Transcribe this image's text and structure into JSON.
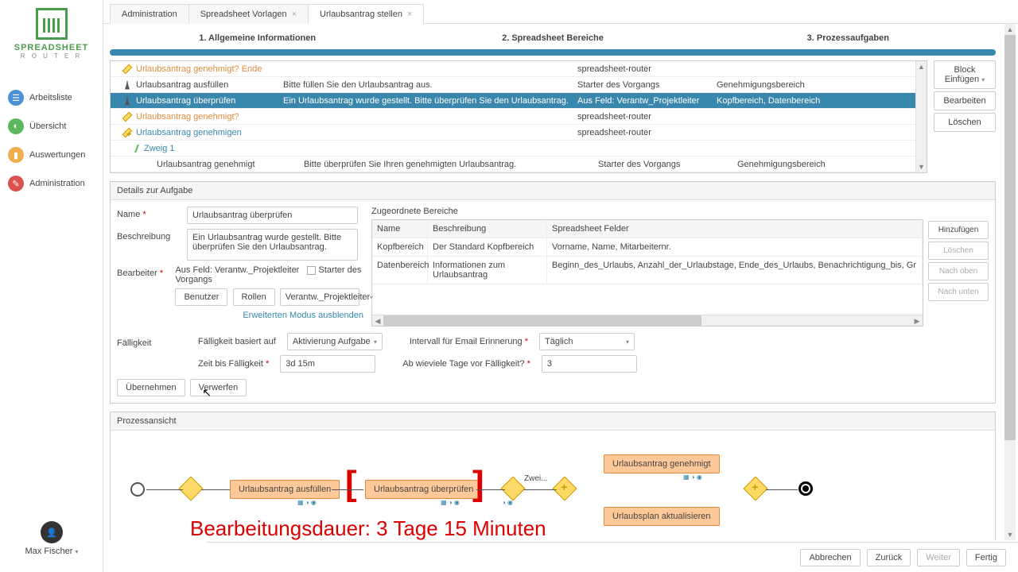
{
  "brand": {
    "name": "SPREADSHEET",
    "sub": "R O U T E R"
  },
  "nav": {
    "arbeitsliste": "Arbeitsliste",
    "uebersicht": "Übersicht",
    "auswertungen": "Auswertungen",
    "administration": "Administration"
  },
  "user": {
    "name": "Max Fischer"
  },
  "tabs": {
    "t1": "Administration",
    "t2": "Spreadsheet Vorlagen",
    "t3": "Urlaubsantrag stellen"
  },
  "steps": {
    "s1": "1. Allgemeine Informationen",
    "s2": "2. Spreadsheet Bereiche",
    "s3": "3. Prozessaufgaben"
  },
  "sideButtons": {
    "blockEinfuegen": "Block Einfügen",
    "bearbeiten": "Bearbeiten",
    "loeschen": "Löschen"
  },
  "taskGrid": {
    "rows": [
      {
        "name": "Urlaubsantrag genehmigt? Ende",
        "desc": "",
        "assignee": "spreadsheet-router",
        "area": "",
        "type": "gateway-orange",
        "indent": "indent1"
      },
      {
        "name": "Urlaubsantrag ausfüllen",
        "desc": "Bitte füllen Sie den Urlaubsantrag aus.",
        "assignee": "Starter des Vorgangs",
        "area": "Genehmigungsbereich",
        "type": "person",
        "indent": "indent1"
      },
      {
        "name": "Urlaubsantrag überprüfen",
        "desc": "Ein Urlaubsantrag wurde gestellt. Bitte überprüfen Sie den Urlaubsantrag.",
        "assignee": "Aus Feld: Verantw_Projektleiter",
        "area": "Kopfbereich, Datenbereich",
        "type": "person",
        "indent": "indent1",
        "selected": true
      },
      {
        "name": "Urlaubsantrag genehmigt?",
        "desc": "",
        "assignee": "spreadsheet-router",
        "area": "",
        "type": "gateway-orange",
        "indent": "indent1"
      },
      {
        "name": "Urlaubsantrag genehmigen",
        "desc": "",
        "assignee": "spreadsheet-router",
        "area": "",
        "type": "plus-gw-link",
        "indent": "indent1"
      },
      {
        "name": "Zweig 1",
        "desc": "",
        "assignee": "",
        "area": "",
        "type": "branch",
        "indent": "indent2"
      },
      {
        "name": "Urlaubsantrag genehmigt",
        "desc": "Bitte überprüfen Sie Ihren genehmigten Urlaubsantrag.",
        "assignee": "Starter des Vorgangs",
        "area": "Genehmigungsbereich",
        "type": "person",
        "indent": "indent3"
      }
    ]
  },
  "details": {
    "header": "Details zur Aufgabe",
    "labels": {
      "name": "Name",
      "beschreibung": "Beschreibung",
      "bearbeiter": "Bearbeiter",
      "faelligkeit": "Fälligkeit",
      "zugeordnete": "Zugeordnete Bereiche"
    },
    "values": {
      "name": "Urlaubsantrag überprüfen",
      "beschreibung": "Ein Urlaubsantrag wurde gestellt. Bitte überprüfen Sie den Urlaubsantrag.",
      "ausFeld": "Aus Feld: Verantw._Projektleiter",
      "starterCheck": "Starter des Vorgangs"
    },
    "buttons": {
      "benutzer": "Benutzer",
      "rollen": "Rollen",
      "selVal": "Verantw._Projektleiter"
    },
    "advLink": "Erweiterten Modus ausblenden",
    "assocTable": {
      "hdr": {
        "name": "Name",
        "beschr": "Beschreibung",
        "felder": "Spreadsheet Felder"
      },
      "r1": {
        "name": "Kopfbereich",
        "beschr": "Der Standard Kopfbereich",
        "felder": "Vorname, Name, Mitarbeiternr."
      },
      "r2": {
        "name": "Datenbereich",
        "beschr": "Informationen zum Urlaubsantrag",
        "felder": "Beginn_des_Urlaubs, Anzahl_der_Urlaubstage, Ende_des_Urlaubs, Benachrichtigung_bis, Gr"
      }
    },
    "assocBtns": {
      "add": "Hinzufügen",
      "del": "Löschen",
      "up": "Nach oben",
      "down": "Nach unten"
    },
    "faell": {
      "basiertLabel": "Fälligkeit basiert auf",
      "basiertVal": "Aktivierung Aufgabe",
      "intervallLabel": "Intervall für Email Erinnerung",
      "intervallVal": "Täglich",
      "zeitLabel": "Zeit bis Fälligkeit",
      "zeitVal": "3d 15m",
      "tageLabel": "Ab wieviele Tage vor Fälligkeit?",
      "tageVal": "3"
    },
    "actions": {
      "uebernehmen": "Übernehmen",
      "verwerfen": "Verwerfen"
    }
  },
  "process": {
    "header": "Prozessansicht",
    "nodes": {
      "n1": "Urlaubsantrag ausfüllen",
      "n2": "Urlaubsantrag überprüfen",
      "n3": "Urlaubsantrag genehmigt",
      "n4": "Urlaubsplan aktualisieren",
      "branch": "Zwei..."
    },
    "overlay": "Bearbeitungsdauer: 3 Tage 15 Minuten"
  },
  "footer": {
    "abbrechen": "Abbrechen",
    "zurueck": "Zurück",
    "weiter": "Weiter",
    "fertig": "Fertig"
  }
}
